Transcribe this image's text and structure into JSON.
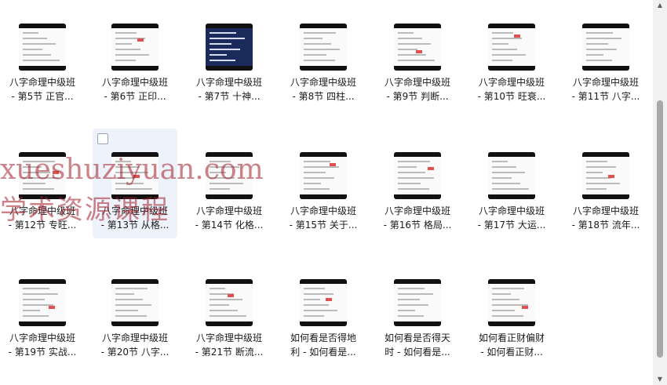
{
  "files": [
    {
      "line1": "八字命理中级班",
      "line2": "- 第5节 正官..."
    },
    {
      "line1": "八字命理中级班",
      "line2": "- 第6节 正印..."
    },
    {
      "line1": "八字命理中级班",
      "line2": "- 第7节 十神..."
    },
    {
      "line1": "八字命理中级班",
      "line2": "- 第8节 四柱..."
    },
    {
      "line1": "八字命理中级班",
      "line2": "- 第9节 判断..."
    },
    {
      "line1": "八字命理中级班",
      "line2": "- 第10节 旺衰..."
    },
    {
      "line1": "八字命理中级班",
      "line2": "- 第11节 八字..."
    },
    {
      "line1": "八字命理中级班",
      "line2": "- 第12节 专旺..."
    },
    {
      "line1": "八字命理中级班",
      "line2": "- 第13节 从格..."
    },
    {
      "line1": "八字命理中级班",
      "line2": "- 第14节 化格..."
    },
    {
      "line1": "八字命理中级班",
      "line2": "- 第15节 关于..."
    },
    {
      "line1": "八字命理中级班",
      "line2": "- 第16节 格局..."
    },
    {
      "line1": "八字命理中级班",
      "line2": "- 第17节 大运..."
    },
    {
      "line1": "八字命理中级班",
      "line2": "- 第18节 流年..."
    },
    {
      "line1": "八字命理中级班",
      "line2": "- 第19节 实战..."
    },
    {
      "line1": "八字命理中级班",
      "line2": "- 第20节 八字..."
    },
    {
      "line1": "八字命理中级班",
      "line2": "- 第21节 断流..."
    },
    {
      "line1": "如何看是否得地",
      "line2": "利 - 如何看是..."
    },
    {
      "line1": "如何看是否得天",
      "line2": "时 - 如何看是..."
    },
    {
      "line1": "如何看正财偏财",
      "line2": "- 如何看正财..."
    }
  ],
  "watermark": {
    "line1": "xueshuziyuan.com",
    "line2": "学术资源课程"
  }
}
